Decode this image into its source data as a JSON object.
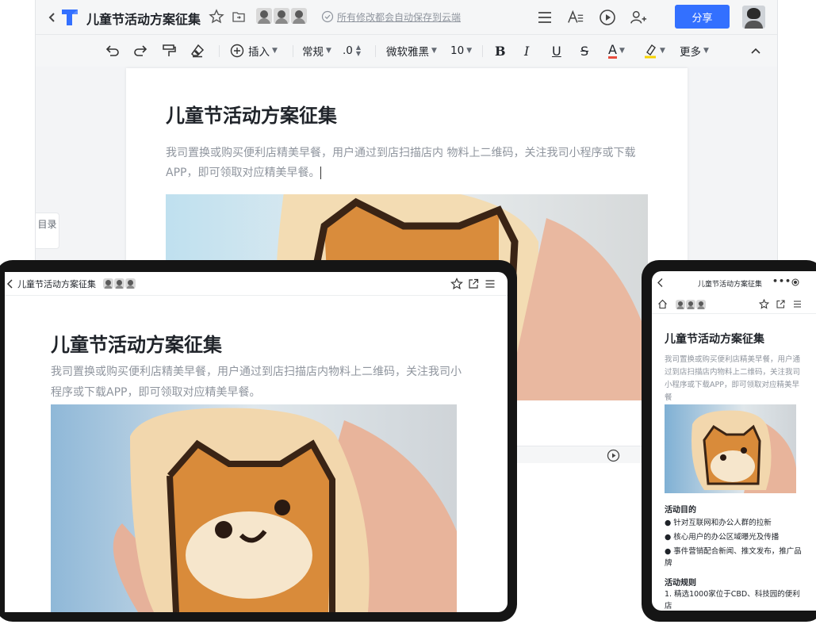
{
  "doc": {
    "title": "儿童节活动方案征集",
    "body": "我司置换或购买便利店精美早餐，用户通过到店扫描店内 物料上二维码，关注我司小程序或下载APP，即可领取对应精美早餐。",
    "body_tablet": "我司置换或购买便利店精美早餐，用户通过到店扫描店内物料上二维码，关注我司小程序或下载APP，即可领取对应精美早餐。",
    "body_phone": "我司置换或购买便利店精美早餐，用户通过到店扫描店内物料上二维码，关注我司小程序或下载APP，即可领取对应精美早餐"
  },
  "desktop": {
    "save_status": "所有修改都会自动保存到云端",
    "share_label": "分享",
    "toc_label": "目录",
    "toolbar": {
      "insert": "插入",
      "style": "常规",
      "spacing": ".0",
      "font": "微软雅黑",
      "size": "10",
      "bold": "B",
      "italic": "I",
      "underline": "U",
      "strike": "S",
      "color": "A",
      "more": "更多"
    }
  },
  "phone": {
    "section1_title": "活动目的",
    "section1_items": [
      "● 针对互联网和办公人群的拉新",
      "● 核心用户的办公区域曝光及传播",
      "● 事件营销配合新闻、推文发布，推广品牌"
    ],
    "section2_title": "活动规则",
    "section2_items": [
      "1.  精选1000家位于CBD、科技园的便利店"
    ]
  },
  "colors": {
    "accent": "#3370ff",
    "text": "#1f2329",
    "muted": "#8f959e",
    "color_underline": "#e84b3c",
    "highlight_underline": "#f7d300"
  },
  "icons": [
    "back-icon",
    "logo-icon",
    "star-icon",
    "folder-icon",
    "check-circle-icon",
    "menu-icon",
    "text-style-icon",
    "play-icon",
    "add-user-icon",
    "undo-icon",
    "redo-icon",
    "format-painter-icon",
    "eraser-icon",
    "plus-circle-icon",
    "highlighter-icon",
    "collapse-icon",
    "share-icon",
    "home-icon",
    "record-icon"
  ]
}
